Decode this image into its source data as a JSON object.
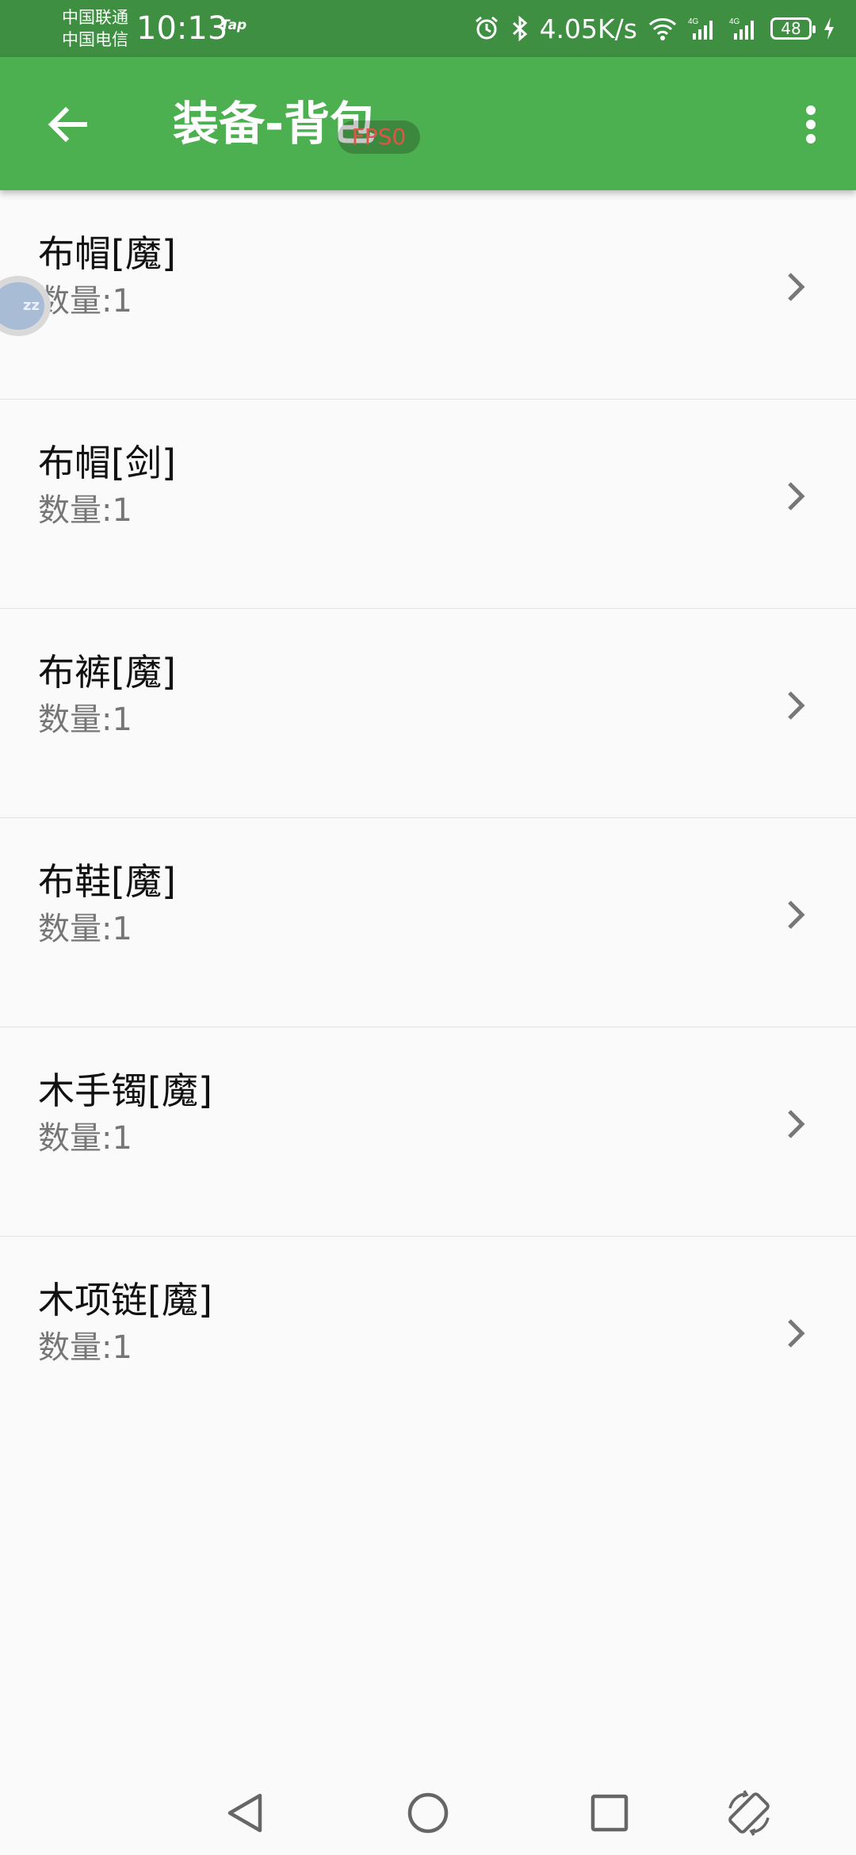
{
  "status_bar": {
    "carrier_top": "中国联通",
    "carrier_bottom": "中国电信",
    "time": "10:13",
    "tap_label": "Tap",
    "net_speed": "4.05K/s",
    "battery": "48"
  },
  "app_bar": {
    "title": "装备-背包",
    "fps_badge": "FPS0"
  },
  "floating_bubble": {
    "label": "zz"
  },
  "items": [
    {
      "name": "布帽[魔]",
      "quantity": "数量:1"
    },
    {
      "name": "布帽[剑]",
      "quantity": "数量:1"
    },
    {
      "name": "布裤[魔]",
      "quantity": "数量:1"
    },
    {
      "name": "布鞋[魔]",
      "quantity": "数量:1"
    },
    {
      "name": "木手镯[魔]",
      "quantity": "数量:1"
    },
    {
      "name": "木项链[魔]",
      "quantity": "数量:1"
    }
  ],
  "colors": {
    "status_bar_bg": "#3e8f42",
    "app_bar_bg": "#4caf50",
    "page_bg": "#fafafa"
  }
}
